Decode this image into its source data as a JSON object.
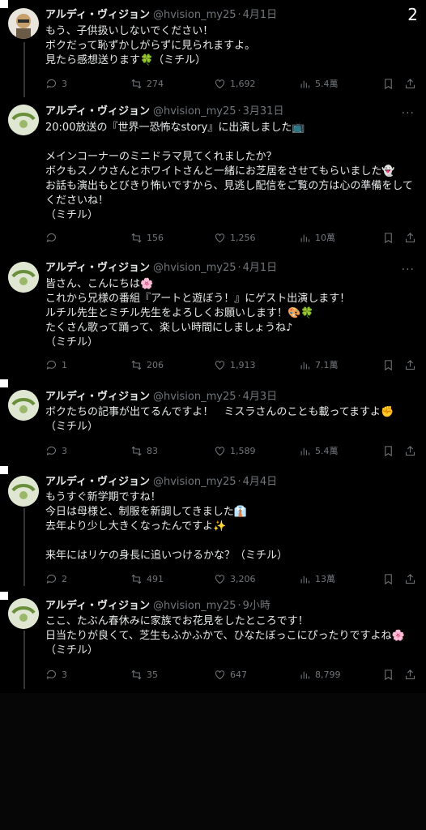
{
  "counter": "2",
  "tweets": [
    {
      "name": "アルディ・ヴィジョン",
      "handle": "@hvision_my25",
      "time": "4月1日",
      "text": "もう、子供扱いしないでください！\nボクだって恥ずかしがらずに見られますよ。\n見たら感想送ります🍀（ミチル）",
      "reply": "3",
      "retweet": "274",
      "like": "1,692",
      "views": "5.4萬"
    },
    {
      "name": "アルディ・ヴィジョン",
      "handle": "@hvision_my25",
      "time": "3月31日",
      "text": "20:00放送の『世界一恐怖なstory』に出演しました📺\n\nメインコーナーのミニドラマ見てくれましたか？\nボクもスノウさんとホワイトさんと一緒にお芝居をさせてもらいました👻\nお話も演出もとびきり怖いですから、見逃し配信をご覧の方は心の準備をしてくださいね！\n（ミチル）",
      "reply": "",
      "retweet": "156",
      "like": "1,256",
      "views": "10萬"
    },
    {
      "name": "アルディ・ヴィジョン",
      "handle": "@hvision_my25",
      "time": "4月1日",
      "text": "皆さん、こんにちは🌸\nこれから兄様の番組『アートと遊ぼう！』にゲスト出演します！\nルチル先生とミチル先生をよろしくお願いします！🎨🍀\nたくさん歌って踊って、楽しい時間にしましょうね♪\n（ミチル）",
      "reply": "1",
      "retweet": "206",
      "like": "1,913",
      "views": "7.1萬"
    },
    {
      "name": "アルディ・ヴィジョン",
      "handle": "@hvision_my25",
      "time": "4月3日",
      "text": "ボクたちの記事が出てるんですよ！　ミスラさんのことも載ってますよ✊\n（ミチル）",
      "reply": "3",
      "retweet": "83",
      "like": "1,589",
      "views": "5.4萬"
    },
    {
      "name": "アルディ・ヴィジョン",
      "handle": "@hvision_my25",
      "time": "4月4日",
      "text": "もうすぐ新学期ですね！\n今日は母様と、制服を新調してきました👔\n去年より少し大きくなったんですよ✨\n\n来年にはリケの身長に追いつけるかな？（ミチル）",
      "reply": "2",
      "retweet": "491",
      "like": "3,206",
      "views": "13萬"
    },
    {
      "name": "アルディ・ヴィジョン",
      "handle": "@hvision_my25",
      "time": "9小時",
      "text": "ここ、たぶん春休みに家族でお花見をしたところです！\n日当たりが良くて、芝生もふかふかで、ひなたぼっこにぴったりですよね🌸\n（ミチル）",
      "reply": "3",
      "retweet": "35",
      "like": "647",
      "views": "8,799"
    }
  ]
}
